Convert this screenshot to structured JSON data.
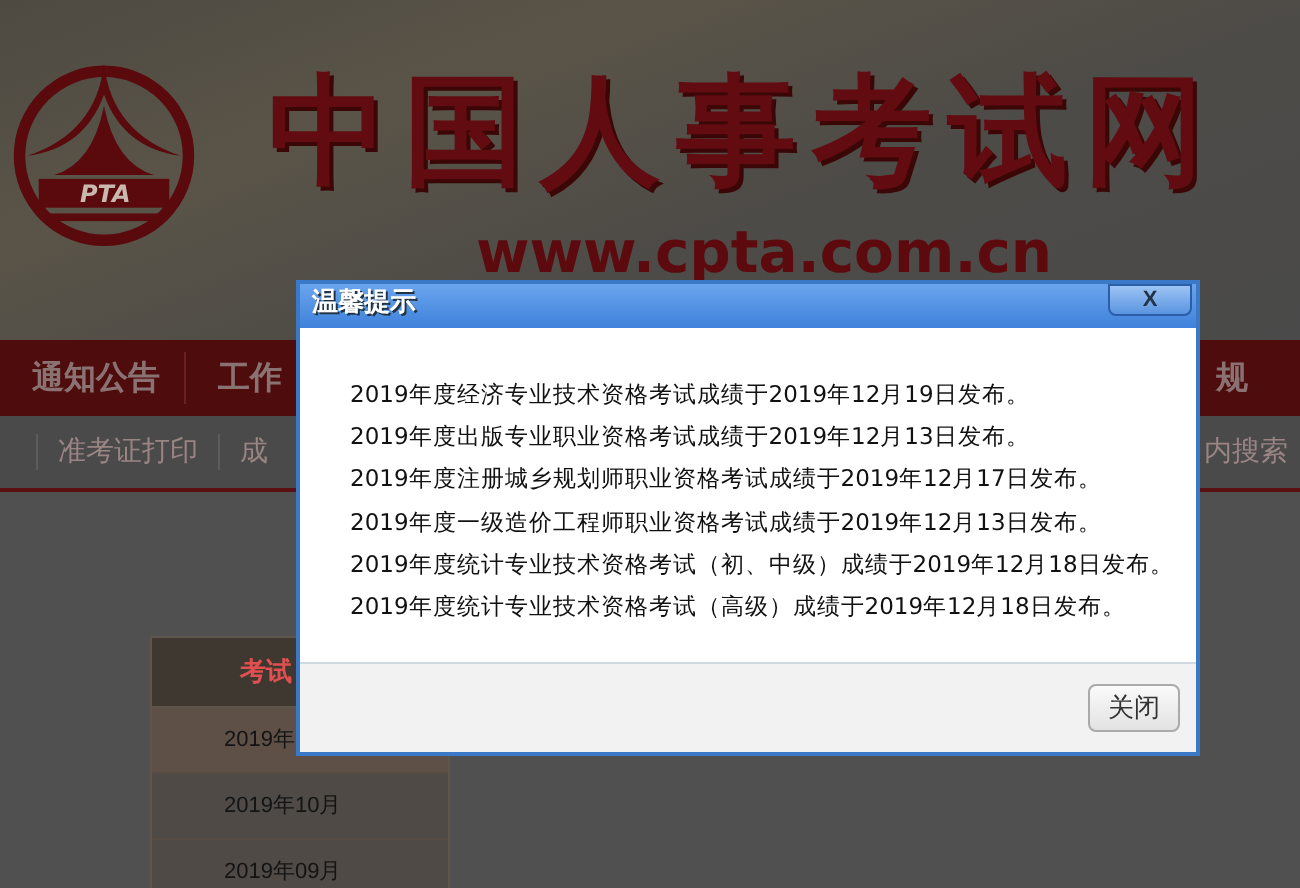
{
  "header": {
    "logo_mark": "PTA",
    "site_name": "中国人事考试网",
    "url": "www.cpta.com.cn"
  },
  "nav": {
    "left": [
      "通知公告",
      "工作"
    ],
    "right": [
      "规"
    ]
  },
  "subnav": {
    "left": [
      "准考证打印",
      "成"
    ],
    "right": [
      "内搜索"
    ]
  },
  "sidebar": {
    "title": "考试",
    "items": [
      {
        "label": "2019年",
        "selected": true
      },
      {
        "label": "2019年10月",
        "selected": false
      },
      {
        "label": "2019年09月",
        "selected": false
      }
    ]
  },
  "dialog": {
    "title": "温馨提示",
    "close": "X",
    "messages": [
      "2019年度经济专业技术资格考试成绩于2019年12月19日发布。",
      "2019年度出版专业职业资格考试成绩于2019年12月13日发布。",
      "2019年度注册城乡规划师职业资格考试成绩于2019年12月17日发布。",
      "2019年度一级造价工程师职业资格考试成绩于2019年12月13日发布。",
      "2019年度统计专业技术资格考试（初、中级）成绩于2019年12月18日发布。",
      "2019年度统计专业技术资格考试（高级）成绩于2019年12月18日发布。"
    ],
    "buttons": [
      "关闭"
    ]
  }
}
